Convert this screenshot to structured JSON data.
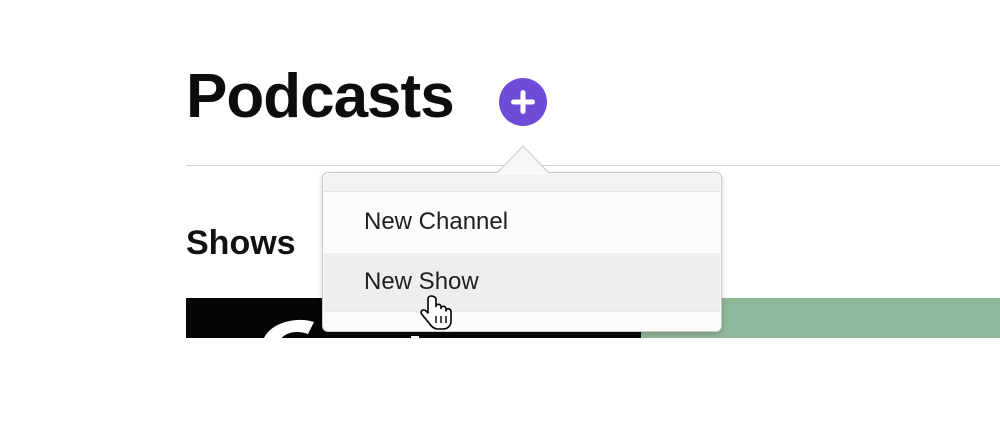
{
  "header": {
    "title": "Podcasts",
    "add_icon": "plus-circle-icon",
    "accent_color": "#6e4bd8"
  },
  "section": {
    "title": "Shows"
  },
  "add_menu": {
    "items": [
      {
        "label": "New Channel",
        "highlighted": false
      },
      {
        "label": "New Show",
        "highlighted": true
      }
    ]
  },
  "tiles": [
    {
      "name": "show-artwork-dark",
      "color": "#050505"
    },
    {
      "name": "show-artwork-green",
      "color": "#8fb89a"
    }
  ],
  "cursor": "pointing-hand-cursor-icon"
}
